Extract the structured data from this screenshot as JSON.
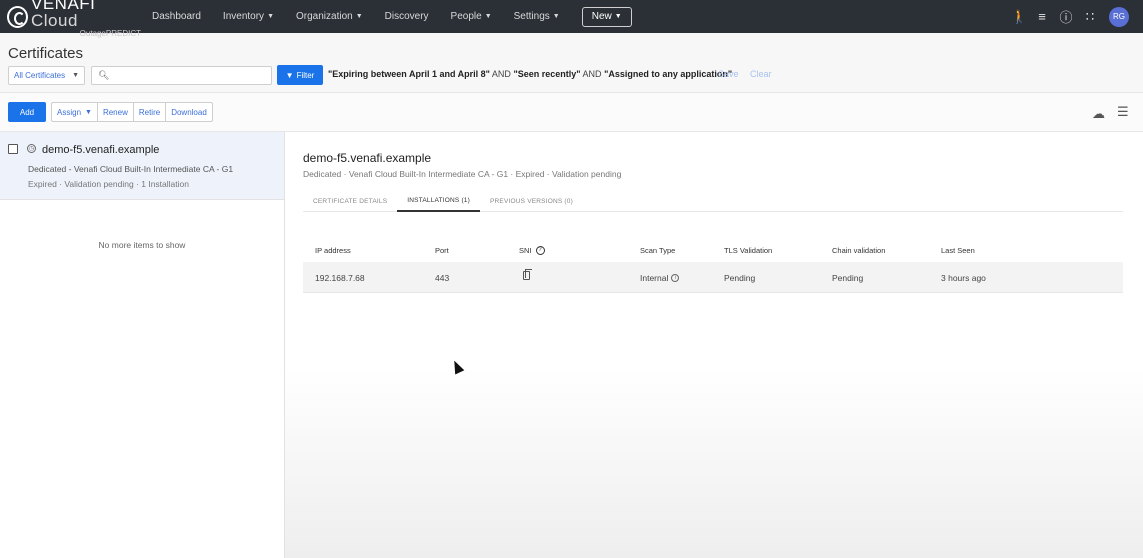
{
  "nav": {
    "brand": "VENAFI",
    "brand_cloud": "Cloud",
    "brand_sub": "OutagePREDICT",
    "items": [
      {
        "label": "Dashboard",
        "caret": false
      },
      {
        "label": "Inventory",
        "caret": true
      },
      {
        "label": "Organization",
        "caret": true
      },
      {
        "label": "Discovery",
        "caret": false
      },
      {
        "label": "People",
        "caret": true
      },
      {
        "label": "Settings",
        "caret": true
      }
    ],
    "new_label": "New",
    "avatar": "RG"
  },
  "page": {
    "title": "Certificates",
    "select_value": "All Certificates",
    "search_placeholder": "",
    "filter_label": "Filter",
    "filter_expr": {
      "part1": "\"Expiring between April 1 and April 8\"",
      "op1": "AND",
      "part2": "\"Seen recently\"",
      "op2": "AND",
      "part3": "\"Assigned to any application\""
    },
    "save_label": "Save",
    "clear_label": "Clear"
  },
  "toolbar": {
    "add": "Add",
    "assign": "Assign",
    "renew": "Renew",
    "retire": "Retire",
    "download": "Download"
  },
  "list": {
    "item": {
      "name": "demo-f5.venafi.example",
      "issuer": "Dedicated - Venafi Cloud Built-In Intermediate CA - G1",
      "meta": "Expired · Validation pending · 1 Installation"
    },
    "empty_text": "No more items to show"
  },
  "detail": {
    "title": "demo-f5.venafi.example",
    "subtitle": "Dedicated · Venafi Cloud Built-In Intermediate CA - G1 · Expired · Validation pending",
    "tabs": [
      "CERTIFICATE DETAILS",
      "INSTALLATIONS (1)",
      "PREVIOUS VERSIONS (0)"
    ],
    "columns": {
      "ip": "IP address",
      "port": "Port",
      "sni": "SNI",
      "scan": "Scan Type",
      "tls": "TLS Validation",
      "chain": "Chain validation",
      "seen": "Last Seen"
    },
    "row": {
      "ip": "192.168.7.68",
      "port": "443",
      "scan": "Internal",
      "tls": "Pending",
      "chain": "Pending",
      "seen": "3 hours ago"
    }
  }
}
